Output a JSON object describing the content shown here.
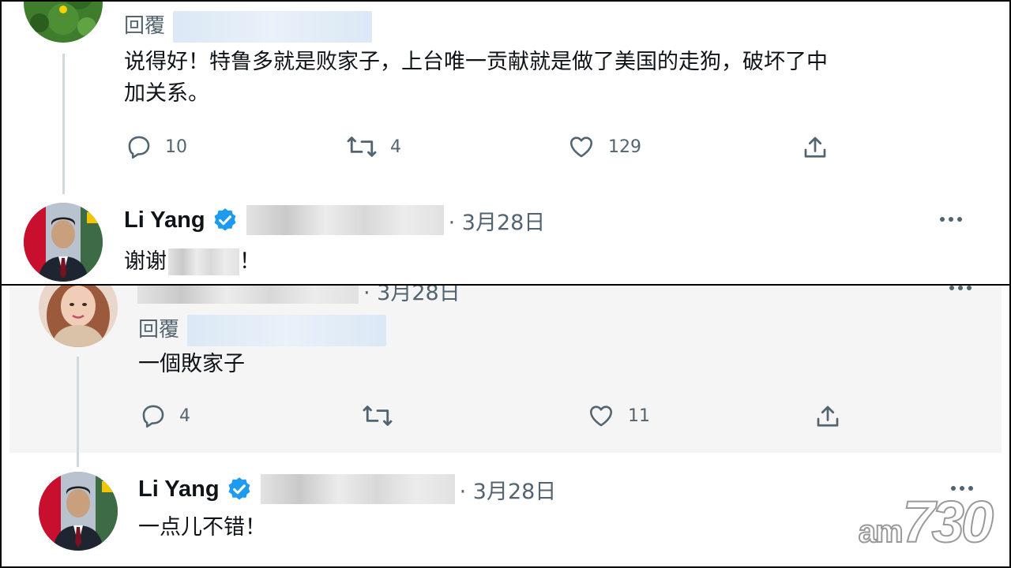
{
  "top_panel": {
    "reply_tweet": {
      "reply_label": "回覆",
      "text_line1": "说得好！特鲁多就是败家子，上台唯一贡献就是做了美国的走狗，破坏了中",
      "text_line2": "加关系。",
      "actions": {
        "replies": "10",
        "retweets": "4",
        "likes": "129"
      }
    },
    "answer_tweet": {
      "name": "Li Yang",
      "date": "· 3月28日",
      "text_start": "谢谢",
      "text_end": "！"
    }
  },
  "bottom_panel": {
    "reply_tweet": {
      "date": "· 3月28日",
      "reply_label": "回覆",
      "text": "一個敗家子",
      "actions": {
        "replies": "4",
        "retweets": "",
        "likes": "11"
      }
    },
    "answer_tweet": {
      "name": "Li Yang",
      "date": "· 3月28日",
      "text": "一点儿不错！"
    }
  },
  "watermark": {
    "prefix": "am",
    "number": "730"
  },
  "icons": [
    "reply-icon",
    "retweet-icon",
    "like-icon",
    "share-icon",
    "verified-badge-icon",
    "more-icon"
  ],
  "colors": {
    "text": "#0f1419",
    "secondary": "#536471",
    "verified": "#1d9bf0",
    "thread_line": "#cfd9de",
    "blur": "#dbe8f5"
  }
}
